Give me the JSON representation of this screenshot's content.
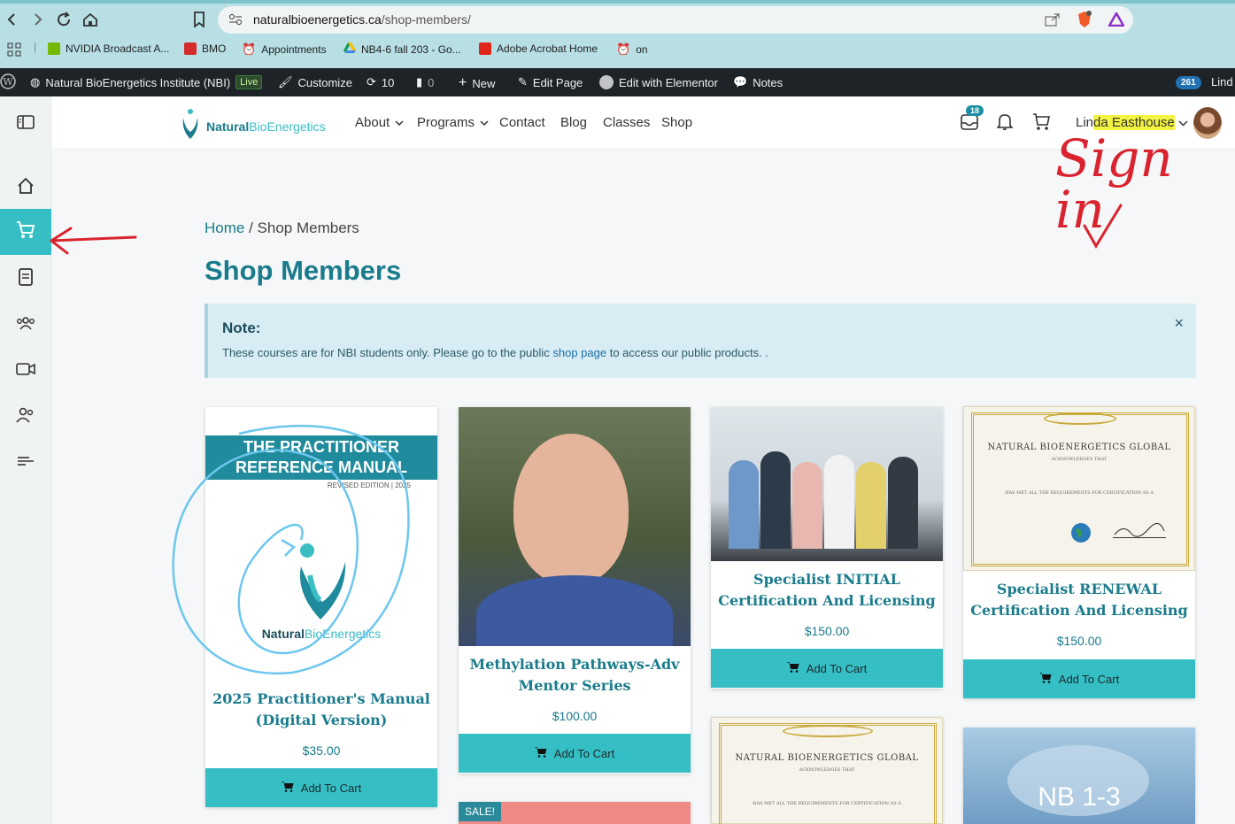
{
  "browser": {
    "url_host": "naturalbioenergetics.ca",
    "url_path": "/shop-members/",
    "bookmarks": [
      "NVIDIA Broadcast A...",
      "BMO",
      "Appointments",
      "NB4-6 fall 203 - Go...",
      "Adobe Acrobat Home",
      "on"
    ]
  },
  "wpbar": {
    "site": "Natural BioEnergetics Institute (NBI)",
    "live": "Live",
    "customize": "Customize",
    "updates": "10",
    "comments": "0",
    "new": "New",
    "edit_page": "Edit Page",
    "elementor": "Edit with Elementor",
    "notes": "Notes",
    "count": "261",
    "user": "Lind"
  },
  "header": {
    "logo_bold": "Natural",
    "logo_light": "BioEnergetics",
    "menu": [
      "About",
      "Programs",
      "Contact",
      "Blog",
      "Classes",
      "Shop"
    ],
    "inbox_count": "18",
    "user_first": "Lin",
    "user_rest": "da Easthouse"
  },
  "breadcrumb": {
    "home": "Home",
    "sep": " / ",
    "current": "Shop Members"
  },
  "page_title": "Shop Members",
  "note": {
    "title": "Note:",
    "text_before": "These courses are for NBI students only. Please go to the public ",
    "link": "shop page",
    "text_after": " to access our public products. .",
    "close": "×"
  },
  "products": [
    {
      "title_line1": "2025 Practitioner's Manual",
      "title_line2": "(Digital Version)",
      "price": "$35.00",
      "button": "Add To Cart",
      "image_line1": "THE PRACTITIONER",
      "image_line2": "REFERENCE MANUAL",
      "image_line3": "REVISED EDITION | 2025",
      "image_logo_bold": "Natural",
      "image_logo_light": "BioEnergetics"
    },
    {
      "title_line1": "Methylation Pathways-Adv",
      "title_line2": "Mentor Series",
      "price": "$100.00",
      "button": "Add To Cart"
    },
    {
      "title_line1": "Specialist INITIAL",
      "title_line2": "Certification And Licensing",
      "price": "$150.00",
      "button": "Add To Cart"
    },
    {
      "title_line1": "Specialist RENEWAL",
      "title_line2": "Certification And Licensing",
      "price": "$150.00",
      "button": "Add To Cart",
      "cert_title": "NATURAL BIOENERGETICS GLOBAL",
      "cert_line1": "ACKNOWLEDGES THAT",
      "cert_line2": "HAS MET ALL THE REQUIREMENTS FOR CERTIFICATION AS A"
    }
  ],
  "row2": {
    "sale": "SALE!",
    "cert_title": "NATURAL BIOENERGETICS GLOBAL",
    "cert_line1": "ACKNOWLEDGES THAT",
    "cert_line2": "HAS MET ALL THE REQUIREMENTS FOR CERTIFICATION AS A",
    "nb_label": "NB 1-3"
  },
  "annotations": {
    "handwriting": "Sign in"
  },
  "colors": {
    "accent": "#35bfc4",
    "brand": "#1a7b8c",
    "note_bg": "#d8ecf4",
    "wpbar": "#1d2327"
  }
}
